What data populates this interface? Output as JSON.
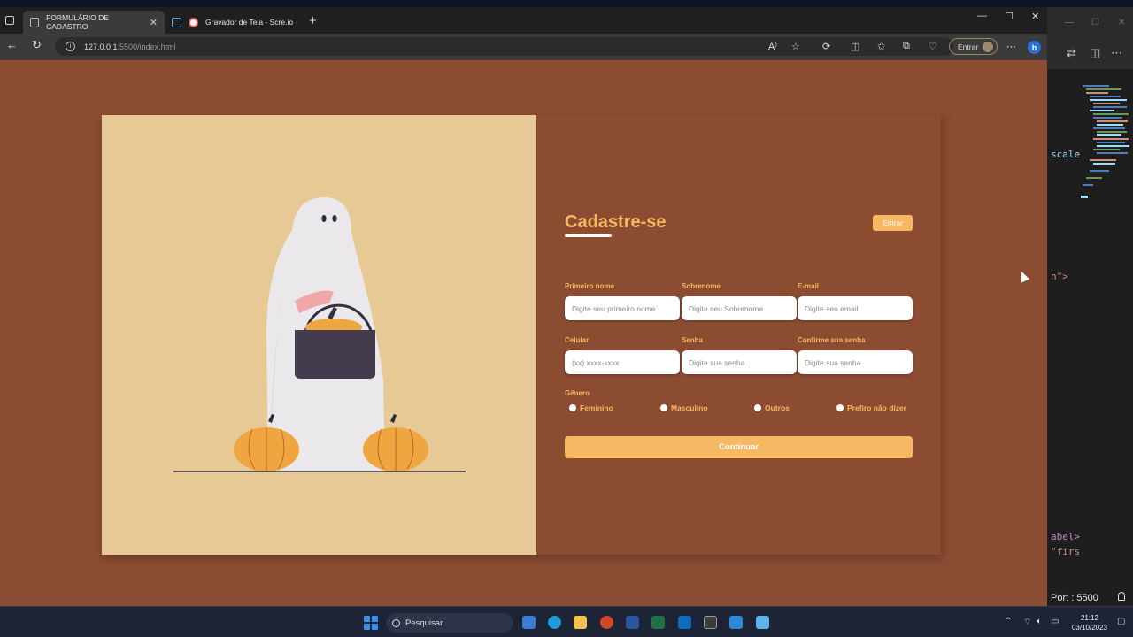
{
  "browser": {
    "tabs": [
      {
        "title": "FORMULÁRIO DE CADASTRO",
        "active": true
      },
      {
        "title": "Gravador de Tela - Scre.io",
        "active": false
      }
    ],
    "url": {
      "host": "127.0.0.1",
      "path": ":5500/index.html"
    },
    "profile_button": "Entrar",
    "reader_icon_text": "A⁾"
  },
  "form": {
    "title": "Cadastre-se",
    "login_button": "Entrar",
    "fields": [
      {
        "label": "Primeiro nome",
        "placeholder": "Digite seu primeiro nome"
      },
      {
        "label": "Sobrenome",
        "placeholder": "Digite seu Sobrenome"
      },
      {
        "label": "E-mail",
        "placeholder": "Digite seu email"
      },
      {
        "label": "Celular",
        "placeholder": "(xx) xxxx-xxxx"
      },
      {
        "label": "Senha",
        "placeholder": "Digite sua senha"
      },
      {
        "label": "Confirme sua senha",
        "placeholder": "Digite sua senha"
      }
    ],
    "gender": {
      "label": "Gênero",
      "options": [
        "Feminino",
        "Masculino",
        "Outros",
        "Prefiro não dizer"
      ]
    },
    "continue_button": "Continuar",
    "colors": {
      "accent": "#f6b862",
      "panel": "#8b4c32",
      "illustration_bg": "#e7c996"
    }
  },
  "vscode": {
    "code_fragments": [
      "scale",
      "n\">",
      "abel>",
      "\"firs"
    ],
    "status": "Port : 5500"
  },
  "taskbar": {
    "search_label": "Pesquisar",
    "time": "21:12",
    "date": "03/10/2023"
  }
}
